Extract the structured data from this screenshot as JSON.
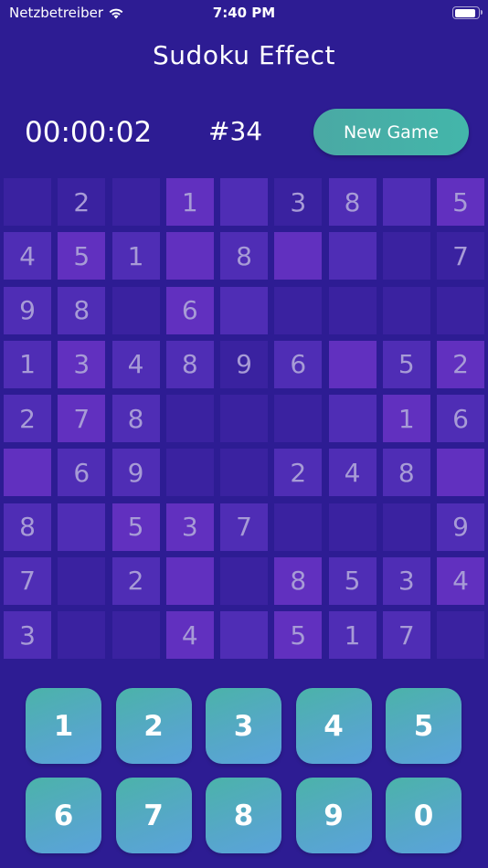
{
  "status_bar": {
    "carrier": "Netzbetreiber",
    "time": "7:40 PM",
    "wifi_icon": "wifi-icon",
    "battery_icon": "battery-icon"
  },
  "header": {
    "title": "Sudoku Effect"
  },
  "toolbar": {
    "timer": "00:00:02",
    "puzzle_number": "#34",
    "new_game_label": "New Game"
  },
  "colors": {
    "background": "#2d1c93",
    "cell_light": "#6130bf",
    "cell_medium": "#4f2db5",
    "cell_dark": "#3a22a0",
    "cell_text": "#a79bd6",
    "button_teal": "#4aa9a4"
  },
  "board": {
    "rows": [
      [
        "",
        "2",
        "",
        "1",
        "",
        "3",
        "8",
        "",
        "5"
      ],
      [
        "4",
        "5",
        "1",
        "",
        "8",
        "",
        "",
        "",
        "7"
      ],
      [
        "9",
        "8",
        "",
        "6",
        "",
        "",
        "",
        "",
        ""
      ],
      [
        "1",
        "3",
        "4",
        "8",
        "9",
        "6",
        "",
        "5",
        "2"
      ],
      [
        "2",
        "7",
        "8",
        "",
        "",
        "",
        "",
        "1",
        "6"
      ],
      [
        "",
        "6",
        "9",
        "",
        "",
        "2",
        "4",
        "8",
        ""
      ],
      [
        "8",
        "",
        "5",
        "3",
        "7",
        "",
        "",
        "",
        "9"
      ],
      [
        "7",
        "",
        "2",
        "",
        "",
        "8",
        "5",
        "3",
        "4"
      ],
      [
        "3",
        "",
        "",
        "4",
        "",
        "5",
        "1",
        "7",
        ""
      ]
    ]
  },
  "keypad": {
    "keys": [
      "1",
      "2",
      "3",
      "4",
      "5",
      "6",
      "7",
      "8",
      "9",
      "0"
    ]
  }
}
